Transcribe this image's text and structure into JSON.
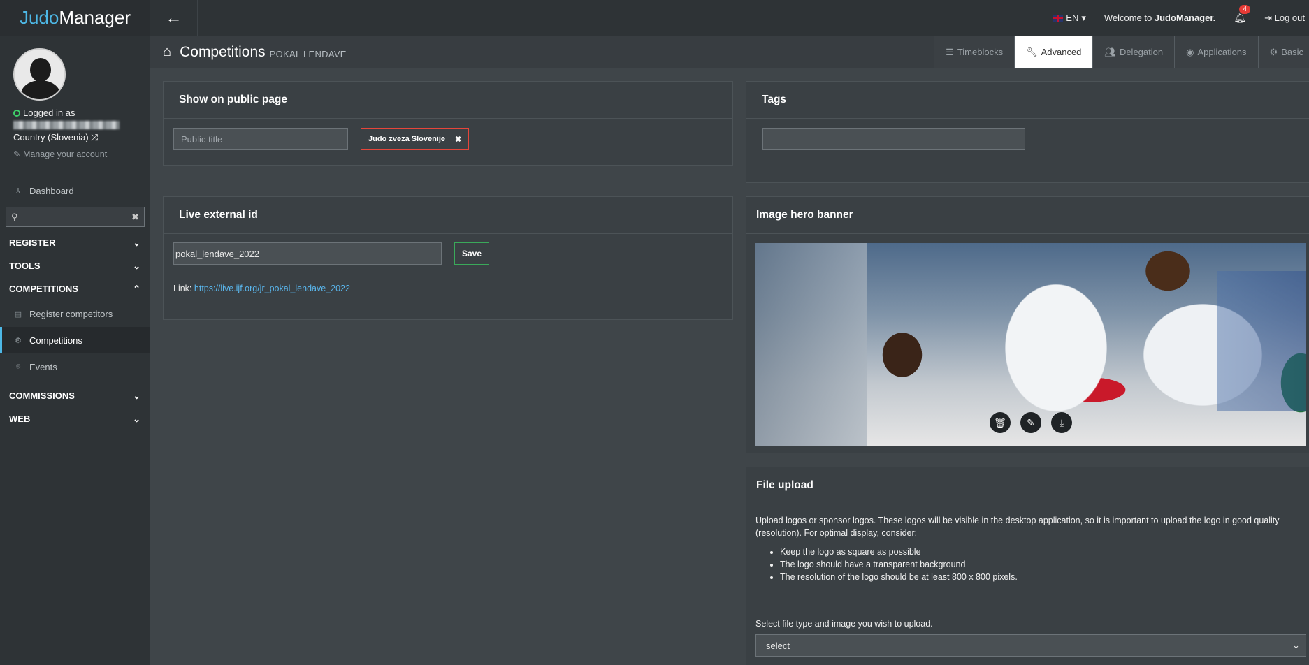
{
  "brand": {
    "part1": "Judo",
    "part2": "Manager"
  },
  "profile": {
    "logged_in_label": "Logged in as",
    "country": "Country (Slovenia)",
    "manage_account": "Manage your account"
  },
  "sidebar": {
    "dashboard": "Dashboard",
    "search_placeholder": "",
    "groups": {
      "register": "REGISTER",
      "tools": "TOOLS",
      "competitions": "COMPETITIONS",
      "commissions": "COMMISSIONS",
      "web": "WEB"
    },
    "competition_items": [
      {
        "label": "Register competitors",
        "icon": "register-icon"
      },
      {
        "label": "Competitions",
        "icon": "gear-icon"
      },
      {
        "label": "Events",
        "icon": "map-pin-icon"
      }
    ]
  },
  "topbar": {
    "language": "EN",
    "welcome_prefix": "Welcome to ",
    "welcome_brand": "JudoManager.",
    "notifications_count": "4",
    "logout": "Log out"
  },
  "titlebar": {
    "title": "Competitions",
    "subtitle": "POKAL LENDAVE",
    "tabs": [
      "Timeblocks",
      "Advanced",
      "Delegation",
      "Applications",
      "Basic"
    ],
    "active_tab": "Advanced"
  },
  "public_page": {
    "heading": "Show on public page",
    "title_placeholder": "Public title",
    "tag_label": "Judo zveza Slovenije"
  },
  "tags": {
    "heading": "Tags",
    "value": ""
  },
  "live_external": {
    "heading": "Live external id",
    "value": "pokal_lendave_2022",
    "save_label": "Save",
    "link_prefix": "Link:",
    "link_url": "https://live.ijf.org/jr_pokal_lendave_2022"
  },
  "hero_banner": {
    "heading": "Image hero banner"
  },
  "file_upload": {
    "heading": "File upload",
    "intro": "Upload logos or sponsor logos. These logos will be visible in the desktop application, so it is important to upload the logo in good quality (resolution). For optimal display, consider:",
    "bullets": [
      "Keep the logo as square as possible",
      "The logo should have a transparent background",
      "The resolution of the logo should be at least 800 x 800 pixels."
    ],
    "select_prompt": "Select file type and image you wish to upload.",
    "select_value": "select"
  },
  "colors": {
    "accent": "#4db8e6",
    "danger": "#e5463b",
    "success": "#3aa95a",
    "online": "#3fd06a"
  }
}
